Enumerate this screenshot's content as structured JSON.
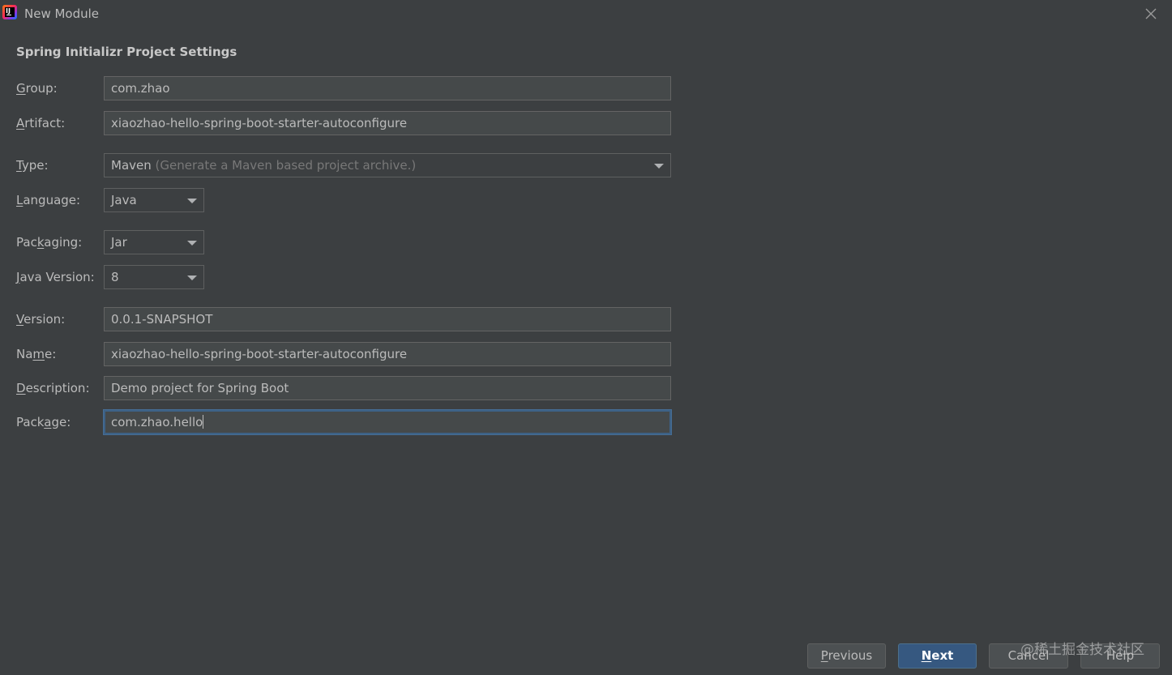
{
  "window": {
    "title": "New Module",
    "app_icon": "intellij-idea-icon"
  },
  "section_title": "Spring Initializr Project Settings",
  "fields": {
    "group": {
      "label_mnemonic": "G",
      "label_rest": "roup:",
      "value": "com.zhao"
    },
    "artifact": {
      "label_mnemonic": "A",
      "label_rest": "rtifact:",
      "value": "xiaozhao-hello-spring-boot-starter-autoconfigure"
    },
    "type": {
      "label_mnemonic": "T",
      "label_rest": "ype:",
      "value": "Maven",
      "hint": "(Generate a Maven based project archive.)"
    },
    "language": {
      "label_mnemonic": "L",
      "label_rest": "anguage:",
      "value": "Java"
    },
    "packaging": {
      "label_pre": "Pac",
      "label_mnemonic": "k",
      "label_rest": "aging:",
      "value": "Jar"
    },
    "java_version": {
      "label_mnemonic": "J",
      "label_rest": "ava Version:",
      "value": "8"
    },
    "version": {
      "label_mnemonic": "V",
      "label_rest": "ersion:",
      "value": "0.0.1-SNAPSHOT"
    },
    "name": {
      "label_pre": "Na",
      "label_mnemonic": "m",
      "label_rest": "e:",
      "value": "xiaozhao-hello-spring-boot-starter-autoconfigure"
    },
    "description": {
      "label_mnemonic": "D",
      "label_rest": "escription:",
      "value": "Demo project for Spring Boot"
    },
    "package": {
      "label_pre": "Pack",
      "label_mnemonic": "a",
      "label_rest": "ge:",
      "value": "com.zhao.hello"
    }
  },
  "buttons": {
    "previous": {
      "mnemonic": "P",
      "rest": "revious"
    },
    "next": {
      "mnemonic": "N",
      "rest": "ext"
    },
    "cancel": {
      "label": "Cancel"
    },
    "help": {
      "label": "Help"
    }
  },
  "watermark": "@稀土掘金技术社区",
  "colors": {
    "background": "#3c3f41",
    "field_bg": "#45494a",
    "primary_button": "#365880",
    "focus_border": "#3d6185"
  }
}
